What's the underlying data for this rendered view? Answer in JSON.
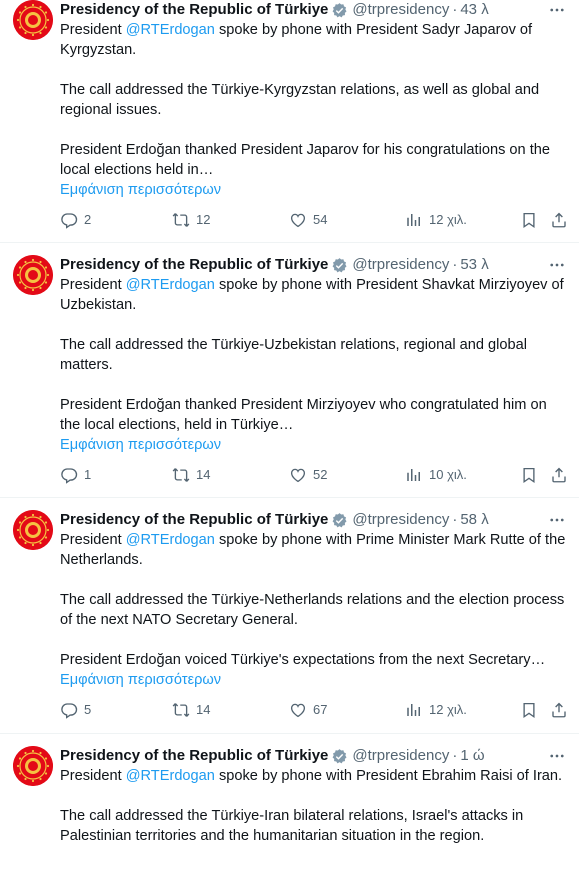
{
  "colors": {
    "accent": "#1d9bf0",
    "text": "#0f1419",
    "muted": "#536471",
    "avatar_red": "#e30a17"
  },
  "tweets": [
    {
      "author": "Presidency of the Republic of Türkiye",
      "handle": "@trpresidency",
      "time": "43 λ",
      "lines": [
        {
          "pre": "President ",
          "mention": "@RTErdogan",
          "post": " spoke by phone with President Sadyr Japarov of Kyrgyzstan."
        },
        {
          "text": "The call addressed the Türkiye-Kyrgyzstan relations, as well as global and regional issues."
        },
        {
          "text": "President Erdoğan thanked President Japarov for his congratulations on the local elections held in…"
        }
      ],
      "show_more": "Εμφάνιση περισσότερων",
      "replies": "2",
      "retweets": "12",
      "likes": "54",
      "views": "12 χιλ."
    },
    {
      "author": "Presidency of the Republic of Türkiye",
      "handle": "@trpresidency",
      "time": "53 λ",
      "lines": [
        {
          "pre": "President ",
          "mention": "@RTErdogan",
          "post": " spoke by phone with President Shavkat Mirziyoyev of Uzbekistan."
        },
        {
          "text": "The call addressed the Türkiye-Uzbekistan relations, regional and global matters."
        },
        {
          "text": "President Erdoğan thanked President Mirziyoyev who congratulated him on the local elections, held in Türkiye…"
        }
      ],
      "show_more": "Εμφάνιση περισσότερων",
      "replies": "1",
      "retweets": "14",
      "likes": "52",
      "views": "10 χιλ."
    },
    {
      "author": "Presidency of the Republic of Türkiye",
      "handle": "@trpresidency",
      "time": "58 λ",
      "lines": [
        {
          "pre": "President ",
          "mention": "@RTErdogan",
          "post": " spoke by phone with Prime Minister Mark Rutte of the Netherlands."
        },
        {
          "text": "The call addressed the Türkiye-Netherlands relations and the election process of the next NATO Secretary General."
        },
        {
          "text": "President Erdoğan voiced Türkiye's expectations from the next Secretary…"
        }
      ],
      "show_more": "Εμφάνιση περισσότερων",
      "replies": "5",
      "retweets": "14",
      "likes": "67",
      "views": "12 χιλ."
    },
    {
      "author": "Presidency of the Republic of Türkiye",
      "handle": "@trpresidency",
      "time": "1 ώ",
      "lines": [
        {
          "pre": "President ",
          "mention": "@RTErdogan",
          "post": " spoke by phone with President Ebrahim Raisi of Iran."
        },
        {
          "text": "The call addressed the Türkiye-Iran bilateral relations, Israel's attacks in Palestinian territories and the humanitarian situation in the region."
        }
      ]
    }
  ]
}
